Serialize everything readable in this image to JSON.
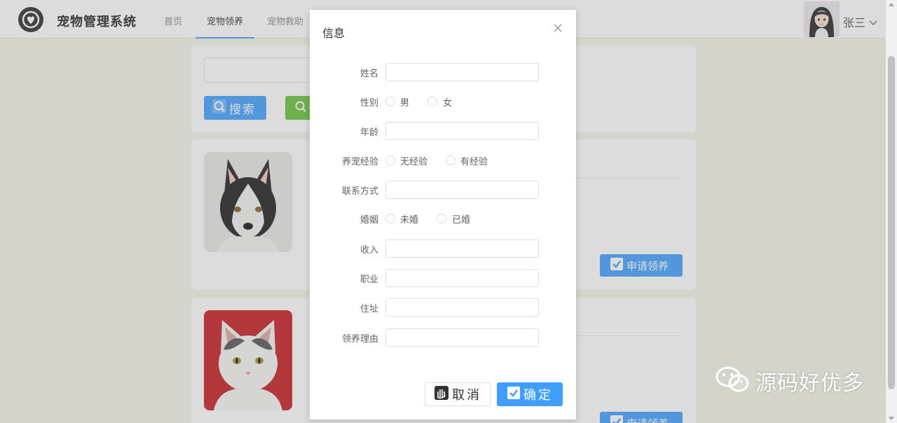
{
  "header": {
    "app_title": "宠物管理系统",
    "nav": [
      {
        "label": "首页"
      },
      {
        "label": "宠物领养"
      },
      {
        "label": "宠物救助"
      }
    ],
    "username": "张三"
  },
  "search": {
    "search_button": "搜索"
  },
  "pet_list": {
    "apply_button": "申请领养"
  },
  "dialog": {
    "title": "信息",
    "fields": {
      "name": {
        "label": "姓名",
        "value": ""
      },
      "gender": {
        "label": "性别",
        "options": [
          "男",
          "女"
        ],
        "selected": null
      },
      "age": {
        "label": "年龄",
        "value": ""
      },
      "experience": {
        "label": "养宠经验",
        "options": [
          "无经验",
          "有经验"
        ],
        "selected": null
      },
      "contact": {
        "label": "联系方式",
        "value": ""
      },
      "marriage": {
        "label": "婚姻",
        "options": [
          "未婚",
          "已婚"
        ],
        "selected": null
      },
      "income": {
        "label": "收入",
        "value": ""
      },
      "occupation": {
        "label": "职业",
        "value": ""
      },
      "address": {
        "label": "住址",
        "value": ""
      },
      "reason": {
        "label": "领养理由",
        "value": ""
      }
    },
    "cancel_button": "取消",
    "confirm_button": "确定"
  },
  "watermark": {
    "text": "源码好优多"
  },
  "colors": {
    "primary": "#409eff",
    "success": "#67c23a",
    "page_background": "#f4f4e8"
  }
}
